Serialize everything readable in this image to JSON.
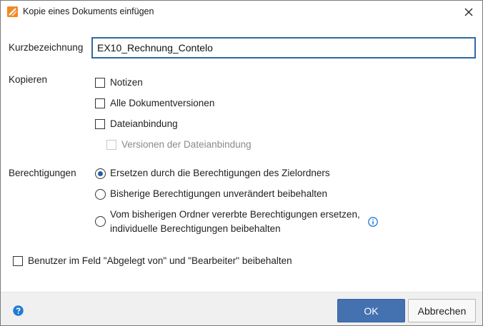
{
  "window": {
    "title": "Kopie eines Dokuments einfügen"
  },
  "form": {
    "short_name_label": "Kurzbezeichnung",
    "short_name_value": "EX10_Rechnung_Contelo",
    "copy_label": "Kopieren",
    "copy_options": [
      {
        "label": "Notizen",
        "checked": false,
        "disabled": false
      },
      {
        "label": "Alle Dokumentversionen",
        "checked": false,
        "disabled": false
      },
      {
        "label": "Dateianbindung",
        "checked": false,
        "disabled": false
      },
      {
        "label": "Versionen der Dateianbindung",
        "checked": false,
        "disabled": true
      }
    ],
    "permissions_label": "Berechtigungen",
    "permission_options": [
      {
        "label": "Ersetzen durch die Berechtigungen des Zielordners",
        "selected": true
      },
      {
        "label": "Bisherige Berechtigungen unverändert beibehalten",
        "selected": false
      },
      {
        "label": "Vom bisherigen Ordner vererbte Berechtigungen ersetzen,",
        "label_line2": "individuelle Berechtigungen beibehalten",
        "selected": false
      }
    ],
    "keep_users_label": "Benutzer im Feld \"Abgelegt von\" und \"Bearbeiter\" beibehalten",
    "keep_users_checked": false
  },
  "footer": {
    "ok_label": "OK",
    "cancel_label": "Abbrechen"
  },
  "icons": {
    "app": "app-logo-icon",
    "close": "close-icon",
    "info": "info-icon",
    "help": "help-icon"
  },
  "colors": {
    "accent": "#4471b0",
    "brand_orange": "#f08a24",
    "focus_border": "#2d6aa5",
    "info_blue": "#1f7ad6"
  }
}
